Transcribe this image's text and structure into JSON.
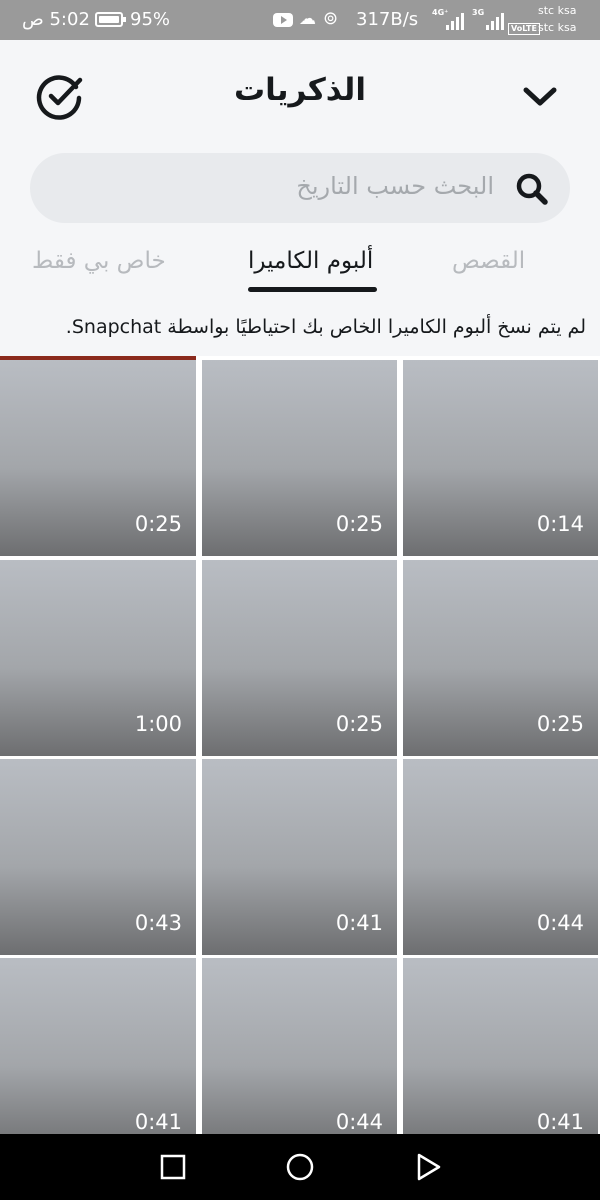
{
  "status_bar": {
    "time": "5:02 ص",
    "battery_percent": "95%",
    "net_speed": "317B/s",
    "sim1_network": "4G⁺",
    "sim2_network": "3G",
    "volte_badge": "VoLTE",
    "carrier_1": "stc ksa",
    "carrier_2": "stc ksa",
    "icons": [
      "youtube-icon",
      "cloud-icon",
      "hotspot-icon",
      "battery-icon",
      "signal-icon"
    ]
  },
  "header": {
    "title": "الذكريات",
    "left_icon": "check-circle-icon",
    "right_icon": "chevron-down-icon"
  },
  "search": {
    "placeholder": "البحث حسب التاريخ",
    "icon": "search-icon"
  },
  "tabs": [
    {
      "label": "القصص",
      "active": false
    },
    {
      "label": "ألبوم الكاميرا",
      "active": true
    },
    {
      "label": "خاص بي فقط",
      "active": false
    }
  ],
  "notice": "لم يتم نسخ ألبوم الكاميرا الخاص بك احتياطيًا بواسطة Snapchat.",
  "media_grid": {
    "rows": [
      [
        "0:14",
        "0:25",
        "0:25"
      ],
      [
        "0:25",
        "0:25",
        "1:00"
      ],
      [
        "0:44",
        "0:41",
        "0:43"
      ],
      [
        "0:41",
        "0:44",
        "0:41"
      ]
    ]
  },
  "nav_bar": {
    "buttons": [
      "square-icon",
      "circle-icon",
      "triangle-icon"
    ]
  },
  "colors": {
    "status_bar": "#9a9a9a",
    "header_bg": "#f5f6f8",
    "text_dark": "#16191c",
    "text_muted": "#b7babe",
    "search_bg": "#e8eaed",
    "accent_strip": "#8b2a1d"
  }
}
